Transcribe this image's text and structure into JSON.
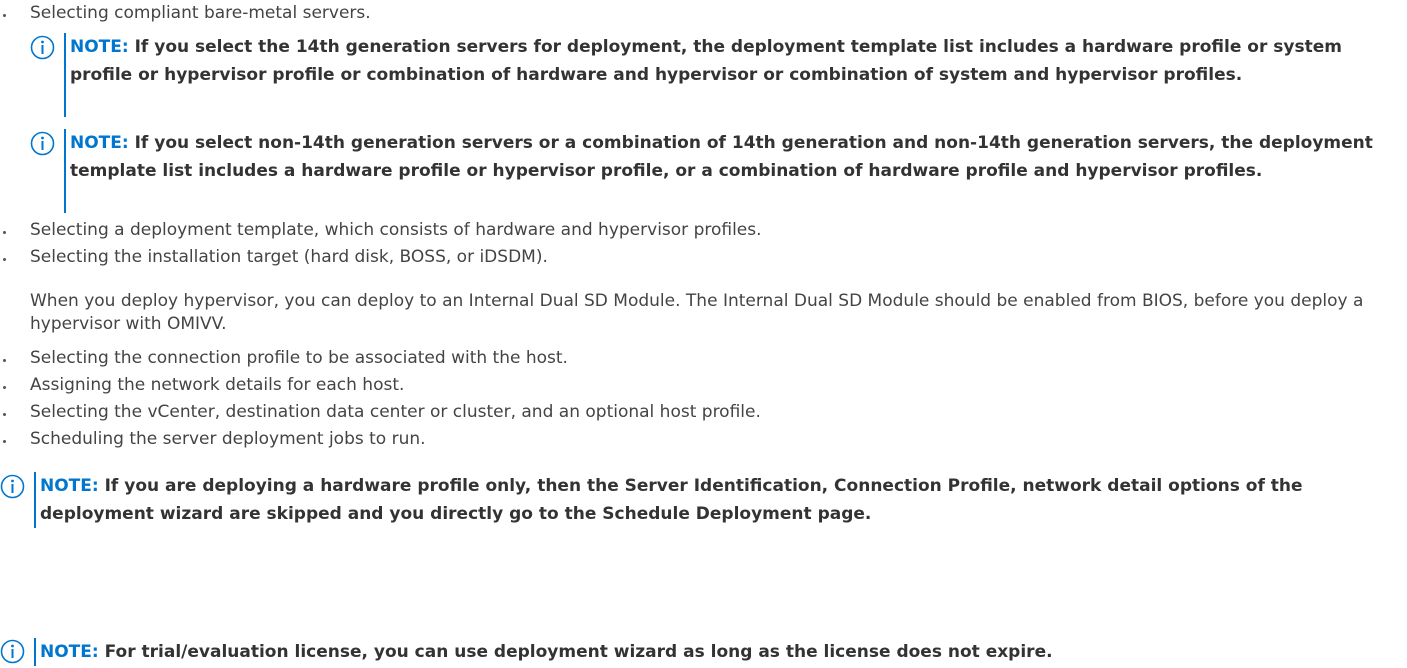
{
  "accent_color": "#0076ce",
  "note_icon": "info-circle-icon",
  "bullets_top": [
    "Selecting compliant bare-metal servers."
  ],
  "notes_nested": [
    {
      "label": "NOTE:",
      "text": "If you select the 14th generation servers for deployment, the deployment template list includes a hardware profile or system profile or hypervisor profile or combination of hardware and hypervisor or combination of system and hypervisor profiles."
    },
    {
      "label": "NOTE:",
      "text": "If you select non-14th generation servers or a combination of 14th generation and non-14th generation servers, the deployment template list includes a hardware profile or hypervisor profile, or a combination of hardware profile and hypervisor profiles."
    }
  ],
  "bullets_middle": [
    "Selecting a deployment template, which consists of hardware and hypervisor profiles.",
    "Selecting the installation target (hard disk, BOSS, or iDSDM)."
  ],
  "paragraph": "When you deploy hypervisor, you can deploy to an Internal Dual SD Module. The Internal Dual SD Module should be enabled from BIOS, before you deploy a hypervisor with OMIVV.",
  "bullets_bottom": [
    "Selecting the connection profile to be associated with the host.",
    "Assigning the network details for each host.",
    "Selecting the vCenter, destination data center or cluster, and an optional host profile.",
    "Scheduling the server deployment jobs to run."
  ],
  "notes_final": [
    {
      "label": "NOTE:",
      "text": "If you are deploying a hardware profile only, then the Server Identification, Connection Profile, network detail options of the deployment wizard are skipped and you directly go to the Schedule Deployment page."
    },
    {
      "label": "NOTE:",
      "text": "For trial/evaluation license, you can use deployment wizard as long as the license does not expire."
    }
  ]
}
